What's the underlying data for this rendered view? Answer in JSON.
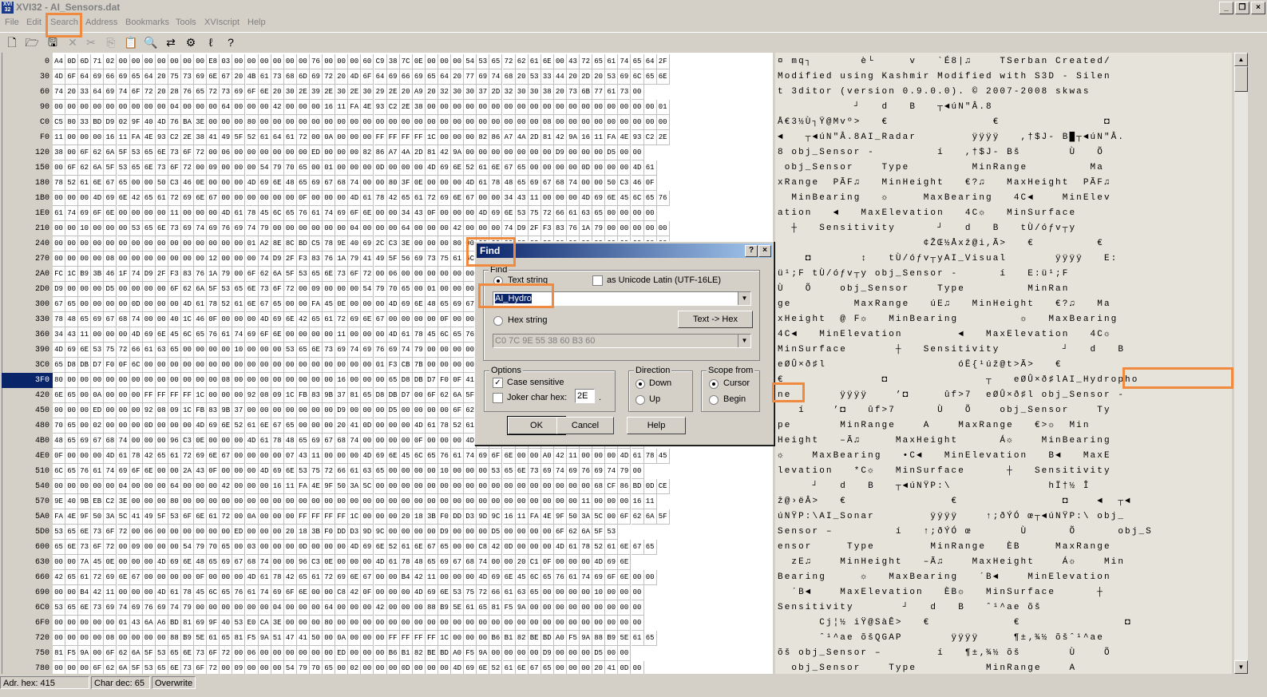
{
  "window": {
    "title": "XVI32 - AI_Sensors.dat",
    "app_icon_text": "XVI 32"
  },
  "menu": [
    "File",
    "Edit",
    "Search",
    "Address",
    "Bookmarks",
    "Tools",
    "XVIscript",
    "Help"
  ],
  "toolbar_icons": [
    "new-file-icon",
    "open-folder-icon",
    "save-icon",
    "close-file-icon",
    "cut-icon",
    "copy-icon",
    "paste-icon",
    "find-icon",
    "find-replace-icon",
    "properties-icon",
    "script-icon",
    "help-pointer-icon"
  ],
  "addresses": [
    "0",
    "30",
    "60",
    "90",
    "C0",
    "F0",
    "120",
    "150",
    "180",
    "1B0",
    "1E0",
    "210",
    "240",
    "270",
    "2A0",
    "2D0",
    "300",
    "330",
    "360",
    "390",
    "3C0",
    "3F0",
    "420",
    "450",
    "480",
    "4B0",
    "4E0",
    "510",
    "540",
    "570",
    "5A0",
    "5D0",
    "600",
    "630",
    "660",
    "690",
    "6C0",
    "6F0",
    "720",
    "750",
    "780"
  ],
  "selected_address": "3F0",
  "hex_rows": [
    "A4 0D 6D 71 02 00 00 00 00 00 00 00 E8 03 00 00 00 00 00 00 76 00 00 00 60 C9 38 7C 0E 00 00 00 54 53 65 72 62 61 6E 00 43 72 65 61 74 65 64 2F",
    "4D 6F 64 69 66 69 65 64 20 75 73 69 6E 67 20 4B 61 73 68 6D 69 72 20 4D 6F 64 69 66 69 65 64 20 77 69 74 68 20 53 33 44 20 2D 20 53 69 6C 65 6E",
    "74 20 33 64 69 74 6F 72 20 28 76 65 72 73 69 6F 6E 20 30 2E 39 2E 30 2E 30 29 2E 20 A9 20 32 30 30 37 2D 32 30 30 38 20 73 6B 77 61 73 00",
    "00 00 00 00 00 00 00 00 00 04 00 00 00 64 00 00 00 42 00 00 00 16 11 FA 4E 93 C2 2E 38 00 00 00 00 00 00 00 00 00 00 00 00 00 00 00 00 00 00 01",
    "C5 80 33 BD D9 02 9F 40 4D 76 BA 3E 00 00 00 80 00 00 00 00 00 00 00 00 00 00 00 00 00 00 00 00 00 00 00 00 00 00 08 00 00 00 00 00 00 00 00 00",
    "11 00 00 00 16 11 FA 4E 93 C2 2E 38 41 49 5F 52 61 64 61 72 00 0A 00 00 00 FF FF FF FF 1C 00 00 00 82 86 A7 4A 2D 81 42 9A 16 11 FA 4E 93 C2 2E",
    "38 00 6F 62 6A 5F 53 65 6E 73 6F 72 00 06 00 00 00 00 00 00 ED 00 00 00 82 86 A7 4A 2D 81 42 9A 00 00 00 00 00 00 00 D9 00 00 00 D5 00 00",
    "00 6F 62 6A 5F 53 65 6E 73 6F 72 00 09 00 00 00 54 79 70 65 00 01 00 00 00 0D 00 00 00 4D 69 6E 52 61 6E 67 65 00 00 00 00 0D 00 00 00 4D 61",
    "78 52 61 6E 67 65 00 00 50 C3 46 0E 00 00 00 4D 69 6E 48 65 69 67 68 74 00 00 80 3F 0E 00 00 00 4D 61 78 48 65 69 67 68 74 00 00 50 C3 46 0F",
    "00 00 00 4D 69 6E 42 65 61 72 69 6E 67 00 00 00 00 00 00 0F 00 00 00 4D 61 78 42 65 61 72 69 6E 67 00 00 34 43 11 00 00 00 4D 69 6E 45 6C 65 76",
    "61 74 69 6F 6E 00 00 00 00 11 00 00 00 4D 61 78 45 6C 65 76 61 74 69 6F 6E 00 00 34 43 0F 00 00 00 4D 69 6E 53 75 72 66 61 63 65 00 00 00 00",
    "00 00 10 00 00 00 53 65 6E 73 69 74 69 76 69 74 79 00 00 00 00 00 00 04 00 00 00 64 00 00 00 42 00 00 00 74 D9 2F F3 83 76 1A 79 00 00 00 00 00",
    "00 00 00 00 00 00 00 00 00 00 00 00 00 00 00 01 A2 8E 8C BD C5 78 9E 40 69 2C C3 3E 00 00 00 80 00 00 00 00 00 00 00 00 00 00 00 00 00 00 00 00",
    "00 00 00 00 08 00 00 00 00 00 00 00 12 00 00 00 74 D9 2F F3 83 76 1A 79 41 49 5F 56 69 73 75 61 6C 00 0A 00 00 00 FF FF FF FF 1C 00 00 00 45 3A",
    "FC 1C B9 3B 46 1F 74 D9 2F F3 83 76 1A 79 00 6F 62 6A 5F 53 65 6E 73 6F 72 00 06 00 00 00 00 00 00 ED 00 00 00 FC 1C B9 3B 46 1F 00 00 00 00 00",
    "D9 00 00 00 D5 00 00 00 00 6F 62 6A 5F 53 65 6E 73 6F 72 00 09 00 00 00 54 79 70 65 00 01 00 00 00 0D 00 00 00 4D 69 6E 52 61 6E 00 00 00 00 00",
    "67 65 00 00 00 00 0D 00 00 00 4D 61 78 52 61 6E 67 65 00 00 FA 45 0E 00 00 00 4D 69 6E 48 65 69 67 68 74 00 00 80 3F 0E 00 00 00 4D 61 00 00",
    "78 48 65 69 67 68 74 00 00 40 1C 46 0F 00 00 00 4D 69 6E 42 65 61 72 69 6E 67 00 00 00 00 0F 00 00 00 4D 61 78 42 65 61 72 69 6E 67 00 00",
    "34 43 11 00 00 00 4D 69 6E 45 6C 65 76 61 74 69 6F 6E 00 00 00 00 11 00 00 00 4D 61 78 45 6C 65 76 61 74 69 6F 6E 00 00 34 43 0F 00 00 00 4D",
    "4D 69 6E 53 75 72 66 61 63 65 00 00 00 00 10 00 00 00 53 65 6E 73 69 74 69 76 69 74 79 00 00 00 00 00 00 00 04 00 00 00 64 00 00 00 42 00",
    "65 D8 DB D7 F0 0F 6C 00 00 00 00 00 00 00 00 00 00 00 00 00 00 00 00 00 00 01 F3 CB 7B 00 00 00 00 00 00 00 00 00 00 00 00 00 00 00 00 00 00",
    "80 00 00 00 00 00 00 00 00 00 00 00 00 08 00 00 00 00 00 00 00 00 16 00 00 00 65 D8 DB D7 F0 0F 41 49 5F 48 79 64 72 6F 70 68 6F 00 00 00",
    "6E 65 00 0A 00 00 00 FF FF FF FF 1C 00 00 00 92 08 09 1C FB 83 9B 37 81 65 D8 DB D7 00 6F 62 6A 5F 53 65 6E 73 6F 72 00 06 00 00 00 00 00",
    "00 00 00 ED 00 00 00 92 08 09 1C FB 83 9B 37 00 00 00 00 00 00 00 D9 00 00 00 D5 00 00 00 00 6F 62 6A 5F 53 65 6E 73 6F 72 00 09 00 00 00 54",
    "70 65 00 02 00 00 00 0D 00 00 00 4D 69 6E 52 61 6E 67 65 00 00 00 20 41 0D 00 00 00 4D 61 78 52 61 6E 67 65 00 00 80 3E 0E 00 00 00 4D 69 6E",
    "48 65 69 67 68 74 00 00 00 96 C3 0E 00 00 00 4D 61 78 48 65 69 67 68 74 00 00 00 00 0F 00 00 00 4D 69 6E 42 65 61 72 69 6E 67 00 00 00 00",
    "0F 00 00 00 4D 61 78 42 65 61 72 69 6E 67 00 00 00 00 07 43 11 00 00 00 4D 69 6E 45 6C 65 76 61 74 69 6F 6E 00 00 A0 42 11 00 00 00 4D 61 78 45",
    "6C 65 76 61 74 69 6F 6E 00 00 2A 43 0F 00 00 00 4D 69 6E 53 75 72 66 61 63 65 00 00 00 00 10 00 00 00 53 65 6E 73 69 74 69 76 69 74 79 00",
    "00 00 00 00 00 04 00 00 00 64 00 00 00 42 00 00 00 16 11 FA 4E 9F 50 3A 5C 00 00 00 00 00 00 00 00 00 00 00 00 00 00 00 00 00 68 CF 86 BD 0D CE",
    "9E 40 9B EB C2 3E 00 00 00 80 00 00 00 00 00 00 00 00 00 00 00 00 00 00 00 00 00 00 00 00 00 00 00 00 00 00 00 00 00 00 00 11 00 00 00 16 11",
    "FA 4E 9F 50 3A 5C 41 49 5F 53 6F 6E 61 72 00 0A 00 00 00 FF FF FF FF 1C 00 00 00 20 18 3B F0 DD D3 9D 9C 16 11 FA 4E 9F 50 3A 5C 00 6F 62 6A 5F",
    "53 65 6E 73 6F 72 00 06 00 00 00 00 00 00 ED 00 00 00 20 18 3B F0 DD D3 9D 9C 00 00 00 00 D9 00 00 00 D5 00 00 00 00 6F 62 6A 5F 53",
    "65 6E 73 6F 72 00 09 00 00 00 54 79 70 65 00 03 00 00 00 0D 00 00 00 4D 69 6E 52 61 6E 67 65 00 00 C8 42 0D 00 00 00 4D 61 78 52 61 6E 67 65",
    "00 00 7A 45 0E 00 00 00 4D 69 6E 48 65 69 67 68 74 00 00 96 C3 0E 00 00 00 4D 61 78 48 65 69 67 68 74 00 00 20 C1 0F 00 00 00 4D 69 6E",
    "42 65 61 72 69 6E 67 00 00 00 00 0F 00 00 00 4D 61 78 42 65 61 72 69 6E 67 00 00 B4 42 11 00 00 00 4D 69 6E 45 6C 65 76 61 74 69 6F 6E 00 00",
    "00 00 B4 42 11 00 00 00 4D 61 78 45 6C 65 76 61 74 69 6F 6E 00 00 C8 42 0F 00 00 00 4D 69 6E 53 75 72 66 61 63 65 00 00 00 00 10 00 00 00",
    "53 65 6E 73 69 74 69 76 69 74 79 00 00 00 00 00 00 04 00 00 00 64 00 00 00 42 00 00 00 88 B9 5E 61 65 81 F5 9A 00 00 00 00 00 00 00 00 00",
    "00 00 00 00 00 01 43 6A A6 BD 81 69 9F 40 53 E0 CA 3E 00 00 00 80 00 00 00 00 00 00 00 00 00 00 00 00 00 00 00 00 00 00 00 00 00 00 00 00",
    "00 00 00 00 08 00 00 00 00 88 B9 5E 61 65 81 F5 9A 51 47 41 50 00 0A 00 00 00 FF FF FF FF 1C 00 00 00 B6 B1 82 BE BD A0 F5 9A 88 B9 5E 61 65",
    "81 F5 9A 00 6F 62 6A 5F 53 65 6E 73 6F 72 00 06 00 00 00 00 00 00 ED 00 00 00 B6 B1 82 BE BD A0 F5 9A 00 00 00 00 D9 00 00 00 D5 00 00",
    "00 00 00 6F 62 6A 5F 53 65 6E 73 6F 72 00 09 00 00 00 54 79 70 65 00 02 00 00 00 0D 00 00 00 4D 69 6E 52 61 6E 67 65 00 00 00 20 41 0D 00"
  ],
  "text_rows": [
    "¤ mq┐       è└     v   `É8|♫    TSerban Created/",
    "Modified using Kashmir Modified with S3D - Silen",
    "t 3ditor (version 0.9.0.0). © 2007-2008 skwas",
    "           ┘   d   B   ┬◄úN\"Â.8",
    "Å€3½Ù┐Ÿ@Mvº>   €               €               ◘",
    "◄   ┬◄úN\"Â.8AI_Radar        ÿÿÿÿ   ,†$J- B█┬◄úN\"Â.",
    "8 obj_Sensor -         í   ,†$J- Bš       Ù   Õ",
    " obj_Sensor    Type         MinRange         Ma",
    "xRange  PÃF♫   MinHeight   €?♫   MaxHeight  PÃF♫",
    "  MinBearing   ☼     MaxBearing   4C◄    MinElev",
    "ation   ◄   MaxElevation   4C☼   MinSurface",
    "  ┼   Sensitivity      ┘   d   B   tÙ/óƒv┬y",
    "                     ¢ŽŒ½Åxž@i,Ã>   €         €",
    "    ◘       ↕   tÙ/óƒv┬yAI_Visual       ÿÿÿÿ   E:",
    "ü¹;F tÙ/óƒv┬y obj_Sensor -      í   E:ü¹;F",
    "Ù   Õ    obj_Sensor    Type         MinRan",
    "ge         MaxRange   úE♫   MinHeight   €?♫   Ma",
    "xHeight  @ F☼   MinBearing         ☼   MaxBearing",
    "4C◄   MinElevation        ◄   MaxElevation   4C☼",
    "MinSurface       ┼   Sensitivity         ┘   d   B",
    "eØÛ×ð♯l                   óË{¹úž@t>Ã>   €",
    "€              ◘              ┬   eØÛ×ð♯lAI_Hydropho",
    "ne       ÿÿÿÿ    ’◘     ûf>7  eØÛ×ð♯l obj_Sensor -",
    "   í    ’◘   ûf>7      Ù   Õ    obj_Sensor    Ty",
    "pe       MinRange    A    MaxRange   €>☼  Min",
    "Height   –Ã♫     MaxHeight      Á☼    MinBearing",
    "☼    MaxBearing   •C◄   MinElevation   B◄   MaxE",
    "levation   *C☼   MinSurface      ┼   Sensitivity",
    "     ┘   d   B   ┬◄úNŸP:\\              hÏ†½ Î",
    "ž@›ëÂ>   €               €               ◘    ◄  ┬◄",
    "úNŸP:\\AI_Sonar        ÿÿÿÿ    ↑;ðÝÓ œ┬◄úNŸP:\\ obj_",
    "Sensor –         í   ↑;ðÝÓ œ       Ù      Õ      obj_S",
    "ensor     Type        MinRange   ÈB     MaxRange",
    "  zE♫    MinHeight   –Ã♫    MaxHeight    Á☼    Min",
    "Bearing     ☼   MaxBearing   ´B◄    MinElevation",
    "  ´B◄    MaxElevation   ÈB☼   MinSurface      ┼",
    "Sensitivity       ┘   d   B   ˆ¹^ae õš",
    "      Cj¦½ iŸ@SàÊ>   €            €               ◘",
    "      ˆ¹^ae õšQGAP       ÿÿÿÿ     ¶±‚¾½ õšˆ¹^ae",
    "õš obj_Sensor –        í   ¶±‚¾½ õš       Ù    Õ",
    "  obj_Sensor    Type          MinRange    A"
  ],
  "dialog": {
    "title": "Find",
    "help_button": "?",
    "close_button": "×",
    "find_group_label": "Find",
    "text_string_label": "Text string",
    "unicode_label": "as Unicode Latin (UTF-16LE)",
    "text_value": "AI_Hydro",
    "hex_string_label": "Hex string",
    "text_to_hex_button": "Text -> Hex",
    "hex_value": "C0 7C 9E 55 38 60 B3 60",
    "options_label": "Options",
    "case_sensitive_label": "Case sensitive",
    "joker_label": "Joker char hex:",
    "joker_value": "2E",
    "joker_dot": ".",
    "direction_label": "Direction",
    "down_label": "Down",
    "up_label": "Up",
    "scope_label": "Scope from",
    "cursor_label": "Cursor",
    "begin_label": "Begin",
    "ok_button": "OK",
    "cancel_button": "Cancel",
    "help_btn_label": "Help"
  },
  "status": {
    "adr_hex": "Adr. hex: 415",
    "char_dec": "Char dec: 65",
    "mode": "Overwrite"
  },
  "window_buttons": [
    "_",
    "❐",
    "×"
  ],
  "scroll_up": "▲",
  "scroll_down": "▼"
}
